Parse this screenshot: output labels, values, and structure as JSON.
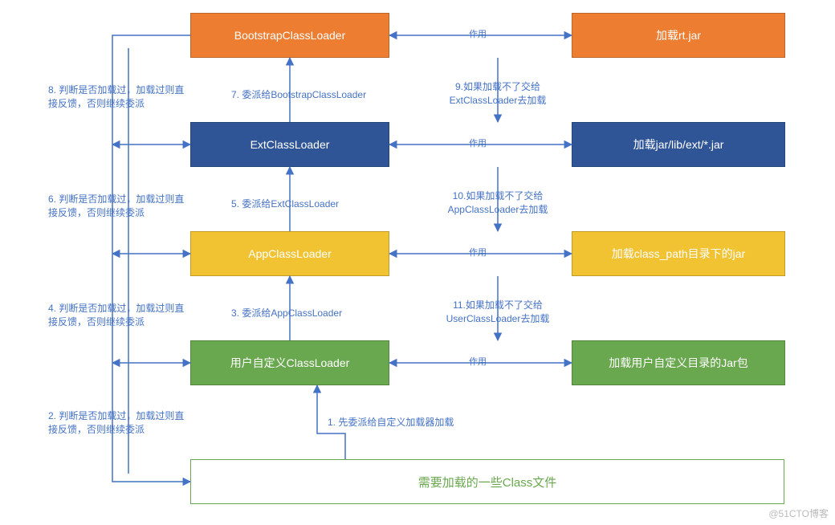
{
  "boxes": {
    "bootstrap": "BootstrapClassLoader",
    "rtjar": "加载rt.jar",
    "ext": "ExtClassLoader",
    "extjar": "加载jar/lib/ext/*.jar",
    "app": "AppClassLoader",
    "classpath": "加载class_path目录下的jar",
    "user": "用户自定义ClassLoader",
    "userjar": "加载用户自定义目录的Jar包",
    "classfile": "需要加载的一些Class文件"
  },
  "labels": {
    "l1": "1. 先委派给自定义加载器加载",
    "l2": "2. 判断是否加载过，加载过则直接反馈，否则继续委派",
    "l3": "3. 委派给AppClassLoader",
    "l4": "4. 判断是否加载过，加载过则直接反馈，否则继续委派",
    "l5": "5. 委派给ExtClassLoader",
    "l6": "6. 判断是否加载过，加载过则直接反馈，否则继续委派",
    "l7": "7. 委派给BootstrapClassLoader",
    "l8": "8. 判断是否加载过，加载过则直接反馈，否则继续委派",
    "l9": "9.如果加载不了交给ExtClassLoader去加载",
    "l10": "10.如果加载不了交给AppClassLoader去加载",
    "l11": "11.如果加载不了交给UserClassLoader去加载",
    "zy": "作用"
  },
  "watermark": "@51CTO博客",
  "colors": {
    "arrow": "#4472c4",
    "orange": "#ed7d31",
    "blue": "#2f5597",
    "yellow": "#f1c232",
    "green": "#6aa84f"
  }
}
